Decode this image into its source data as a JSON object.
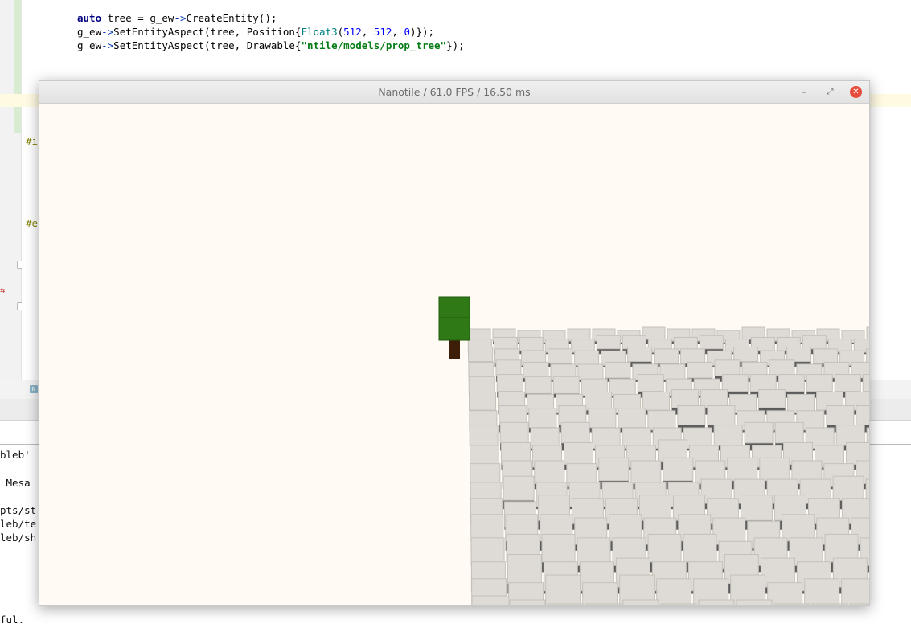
{
  "editor": {
    "code": {
      "line1_kw": "auto",
      "line1_a": " tree = g_ew",
      "line1_arrow": "->",
      "line1_b": "CreateEntity();",
      "line2_a": "g_ew",
      "line2_arrow": "->",
      "line2_b": "SetEntityAspect(tree, Position{",
      "line2_type": "Float3",
      "line2_c": "(",
      "line2_n1": "512",
      "line2_d": ", ",
      "line2_n2": "512",
      "line2_e": ", ",
      "line2_n3": "0",
      "line2_f": ")});",
      "line3_a": "g_ew",
      "line3_arrow": "->",
      "line3_b": "SetEntityAspect(tree, Drawable{",
      "line3_str": "\"ntile/models/prop_tree\"",
      "line3_c": "});"
    },
    "preproc_1": "#i",
    "preproc_2": "#e"
  },
  "status": {
    "badge": "N"
  },
  "console": {
    "lines": [
      "bleb'",
      " Mesa",
      "pts/st",
      "leb/te",
      "leb/sh",
      "ful."
    ]
  },
  "window": {
    "title": "Nanotile / 61.0 FPS / 16.50 ms",
    "minimize_glyph": "–",
    "maximize_glyph": "⤢",
    "close_glyph": "✕"
  },
  "scene": {
    "background": "#fffaf3",
    "tile_top_color": "#dedbd6",
    "tile_side_color": "#5c5c5c",
    "tree_foliage_color": "#2f7a16",
    "tree_trunk_color": "#3d1e08"
  }
}
